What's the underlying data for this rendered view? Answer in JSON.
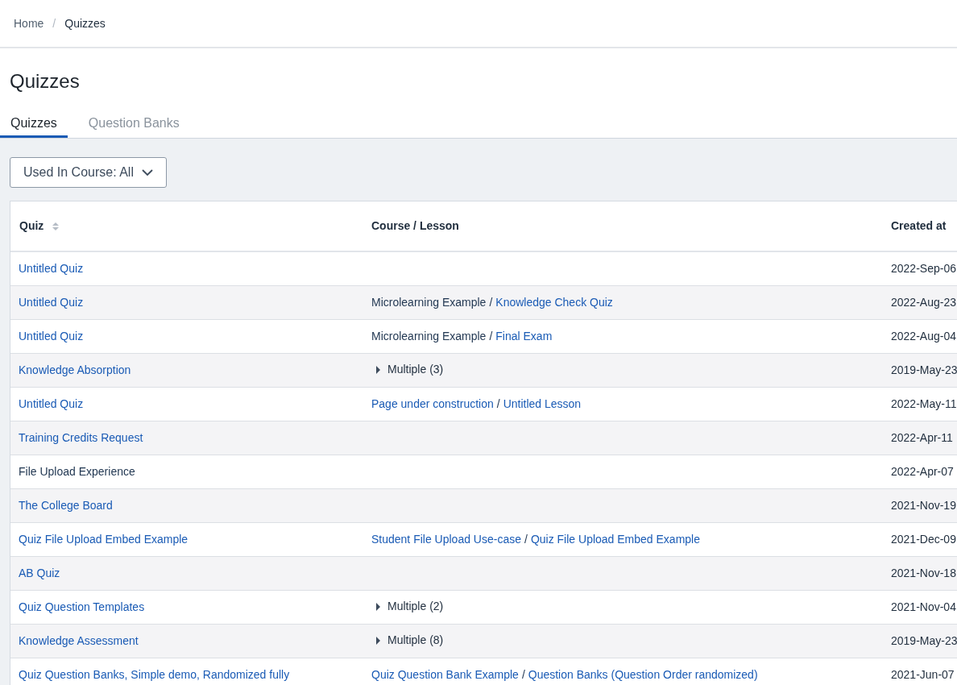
{
  "breadcrumb": [
    {
      "label": "Home",
      "link": true
    },
    {
      "label": "Quizzes",
      "link": false
    }
  ],
  "breadcrumb_separator": "/",
  "page_title": "Quizzes",
  "tabs": [
    {
      "label": "Quizzes",
      "selected": true
    },
    {
      "label": "Question Banks",
      "selected": false
    }
  ],
  "filter": {
    "label": "Used In Course: All"
  },
  "table": {
    "columns": [
      {
        "label": "Quiz",
        "sortable": true
      },
      {
        "label": "Course / Lesson",
        "sortable": false
      },
      {
        "label": "Created at",
        "sortable": false
      }
    ],
    "path_separator": "/",
    "rows": [
      {
        "quiz": {
          "text": "Untitled Quiz",
          "link": true
        },
        "course": {
          "kind": "none"
        },
        "created": "2022-Sep-06"
      },
      {
        "quiz": {
          "text": "Untitled Quiz",
          "link": true
        },
        "course": {
          "kind": "path",
          "parts": [
            {
              "text": "Microlearning Example",
              "link": false
            },
            {
              "text": "Knowledge Check Quiz",
              "link": true
            }
          ]
        },
        "created": "2022-Aug-23"
      },
      {
        "quiz": {
          "text": "Untitled Quiz",
          "link": true
        },
        "course": {
          "kind": "path",
          "parts": [
            {
              "text": "Microlearning Example",
              "link": false
            },
            {
              "text": "Final Exam",
              "link": true
            }
          ]
        },
        "created": "2022-Aug-04"
      },
      {
        "quiz": {
          "text": "Knowledge Absorption",
          "link": true
        },
        "course": {
          "kind": "multiple",
          "text": "Multiple (3)",
          "expanded": false
        },
        "created": "2019-May-23"
      },
      {
        "quiz": {
          "text": "Untitled Quiz",
          "link": true
        },
        "course": {
          "kind": "path",
          "parts": [
            {
              "text": "Page under construction",
              "link": true
            },
            {
              "text": "Untitled Lesson",
              "link": true
            }
          ]
        },
        "created": "2022-May-11"
      },
      {
        "quiz": {
          "text": "Training Credits Request",
          "link": true
        },
        "course": {
          "kind": "none"
        },
        "created": "2022-Apr-11"
      },
      {
        "quiz": {
          "text": "File Upload Experience",
          "link": false
        },
        "course": {
          "kind": "none"
        },
        "created": "2022-Apr-07"
      },
      {
        "quiz": {
          "text": "The College Board",
          "link": true
        },
        "course": {
          "kind": "none"
        },
        "created": "2021-Nov-19"
      },
      {
        "quiz": {
          "text": "Quiz File Upload Embed Example",
          "link": true
        },
        "course": {
          "kind": "path",
          "parts": [
            {
              "text": "Student File Upload Use-case",
              "link": true
            },
            {
              "text": "Quiz File Upload Embed Example",
              "link": true
            }
          ]
        },
        "created": "2021-Dec-09"
      },
      {
        "quiz": {
          "text": "AB Quiz",
          "link": true
        },
        "course": {
          "kind": "none"
        },
        "created": "2021-Nov-18"
      },
      {
        "quiz": {
          "text": "Quiz Question Templates",
          "link": true
        },
        "course": {
          "kind": "multiple",
          "text": "Multiple (2)",
          "expanded": false
        },
        "created": "2021-Nov-04"
      },
      {
        "quiz": {
          "text": "Knowledge Assessment",
          "link": true
        },
        "course": {
          "kind": "multiple",
          "text": "Multiple (8)",
          "expanded": false
        },
        "created": "2019-May-23"
      },
      {
        "quiz": {
          "text": "Quiz Question Banks, Simple demo, Randomized fully",
          "link": true
        },
        "course": {
          "kind": "path",
          "parts": [
            {
              "text": "Quiz Question Bank Example",
              "link": true
            },
            {
              "text": "Question Banks (Question Order randomized)",
              "link": true
            }
          ]
        },
        "created": "2021-Jun-07"
      }
    ]
  }
}
